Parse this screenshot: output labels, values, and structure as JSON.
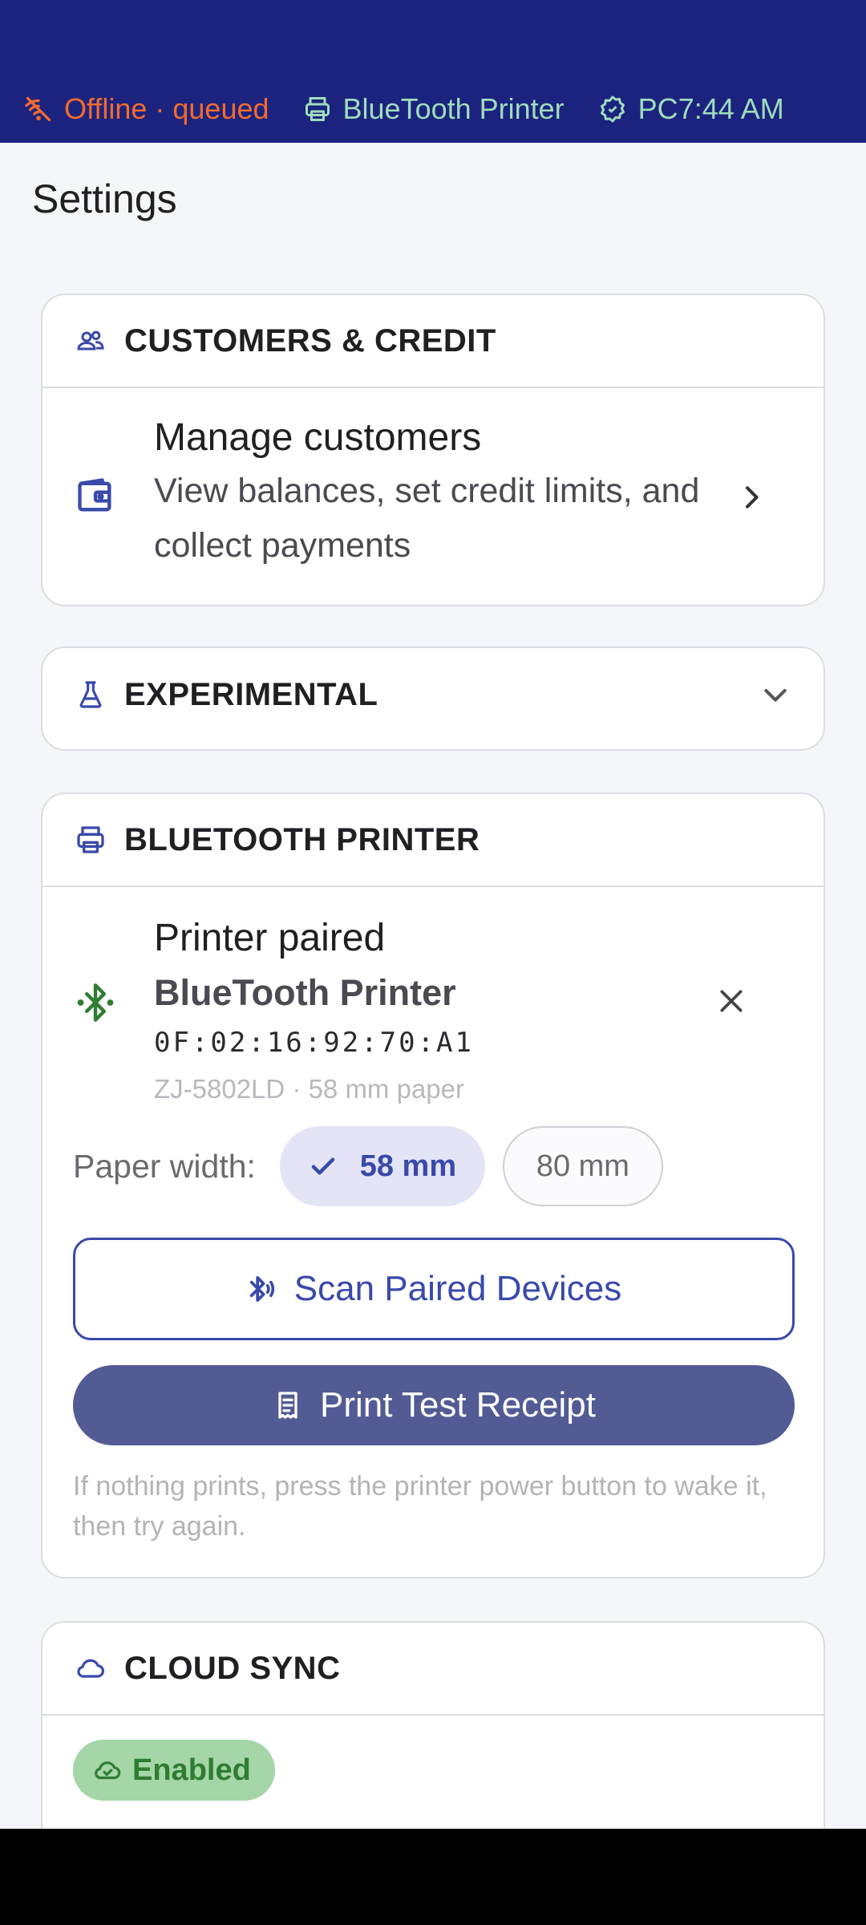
{
  "status_bar": {
    "offline_label": "Offline · queued",
    "printer_label": "BlueTooth Printer",
    "pc_label": "PC",
    "time": "7:44 AM",
    "offline_color": "#f26b2e",
    "ok_color": "#9fdcbc"
  },
  "page": {
    "title": "Settings"
  },
  "customers_card": {
    "header": "CUSTOMERS & CREDIT",
    "item_title": "Manage customers",
    "item_subtitle": "View balances, set credit limits, and collect payments"
  },
  "experimental_card": {
    "header": "EXPERIMENTAL"
  },
  "printer_card": {
    "header": "BLUETOOTH PRINTER",
    "paired_label": "Printer paired",
    "printer_name": "BlueTooth Printer",
    "mac_address": "0F:02:16:92:70:A1",
    "model_info": "ZJ-5802LD · 58 mm paper",
    "paper_width_label": "Paper width:",
    "paper_options": [
      "58 mm",
      "80 mm"
    ],
    "paper_selected": "58 mm",
    "scan_button": "Scan Paired Devices",
    "print_button": "Print Test Receipt",
    "hint": "If nothing prints, press the printer power button to wake it, then try again."
  },
  "cloud_card": {
    "header": "CLOUD SYNC",
    "status_badge": "Enabled"
  },
  "colors": {
    "primary": "#3949ab",
    "status_bar_bg": "#1b237e",
    "filled_button": "#525b94",
    "bluetooth_green": "#2e7d32"
  }
}
